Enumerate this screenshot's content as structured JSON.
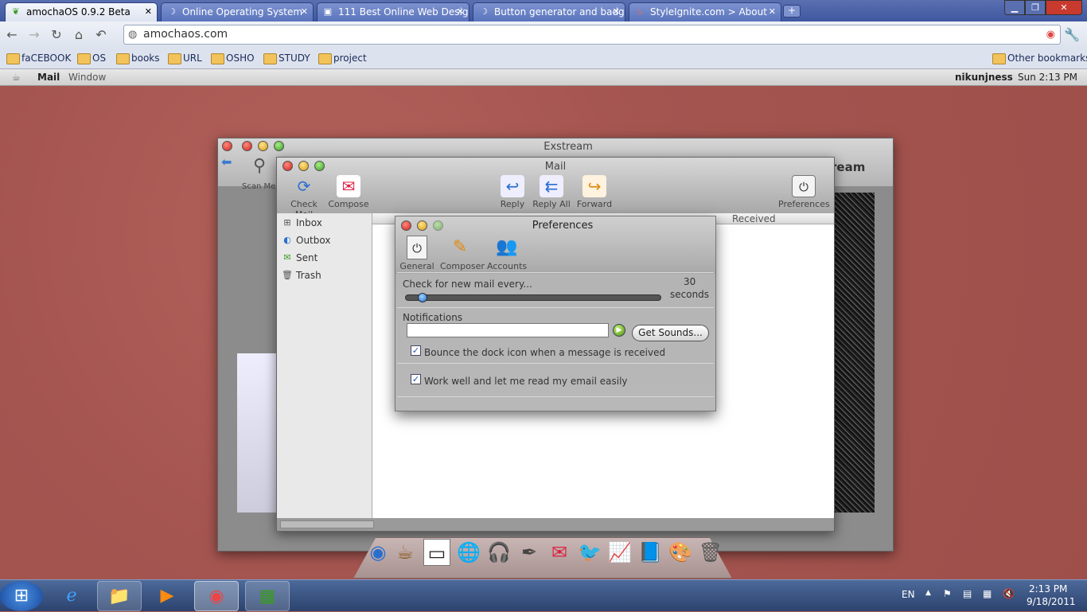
{
  "browser": {
    "tabs": [
      {
        "title": "amochaOS 0.9.2 Beta",
        "active": true
      },
      {
        "title": "Online Operating System"
      },
      {
        "title": "111 Best Online Web Desig"
      },
      {
        "title": "Button generator and badg"
      },
      {
        "title": "StyleIgnite.com > About"
      }
    ],
    "url": "amochaos.com",
    "bookmarks": [
      "faCEBOOK",
      "OS",
      "books",
      "URL",
      "OSHO",
      "STUDY",
      "project"
    ],
    "other_bookmarks": "Other bookmarks"
  },
  "os_menu": {
    "items": [
      "Mail",
      "Window"
    ],
    "user": "nikunjness",
    "clock": "Sun 2:13 PM"
  },
  "back_window": {
    "title": "Exstream",
    "scan_label": "Scan Me",
    "right_text": "ream"
  },
  "mail": {
    "title": "Mail",
    "toolbar": {
      "check": "Check Mail",
      "compose": "Compose",
      "reply": "Reply",
      "reply_all": "Reply All",
      "forward": "Forward",
      "preferences": "Preferences"
    },
    "mailboxes": [
      "Inbox",
      "Outbox",
      "Sent",
      "Trash"
    ],
    "columns": {
      "received": "Received"
    }
  },
  "prefs": {
    "title": "Preferences",
    "tabs": [
      "General",
      "Composer",
      "Accounts"
    ],
    "check_label": "Check for new mail every...",
    "check_value": "30",
    "check_unit": "seconds",
    "slider_level": 0.05,
    "notifications_label": "Notifications",
    "sound_value": "",
    "get_sounds": "Get Sounds...",
    "bounce_label": "Bounce the dock icon when a message is received",
    "work_label": "Work well and let me read my email easily"
  },
  "taskbar": {
    "lang": "EN",
    "time": "2:13 PM",
    "date": "9/18/2011"
  }
}
